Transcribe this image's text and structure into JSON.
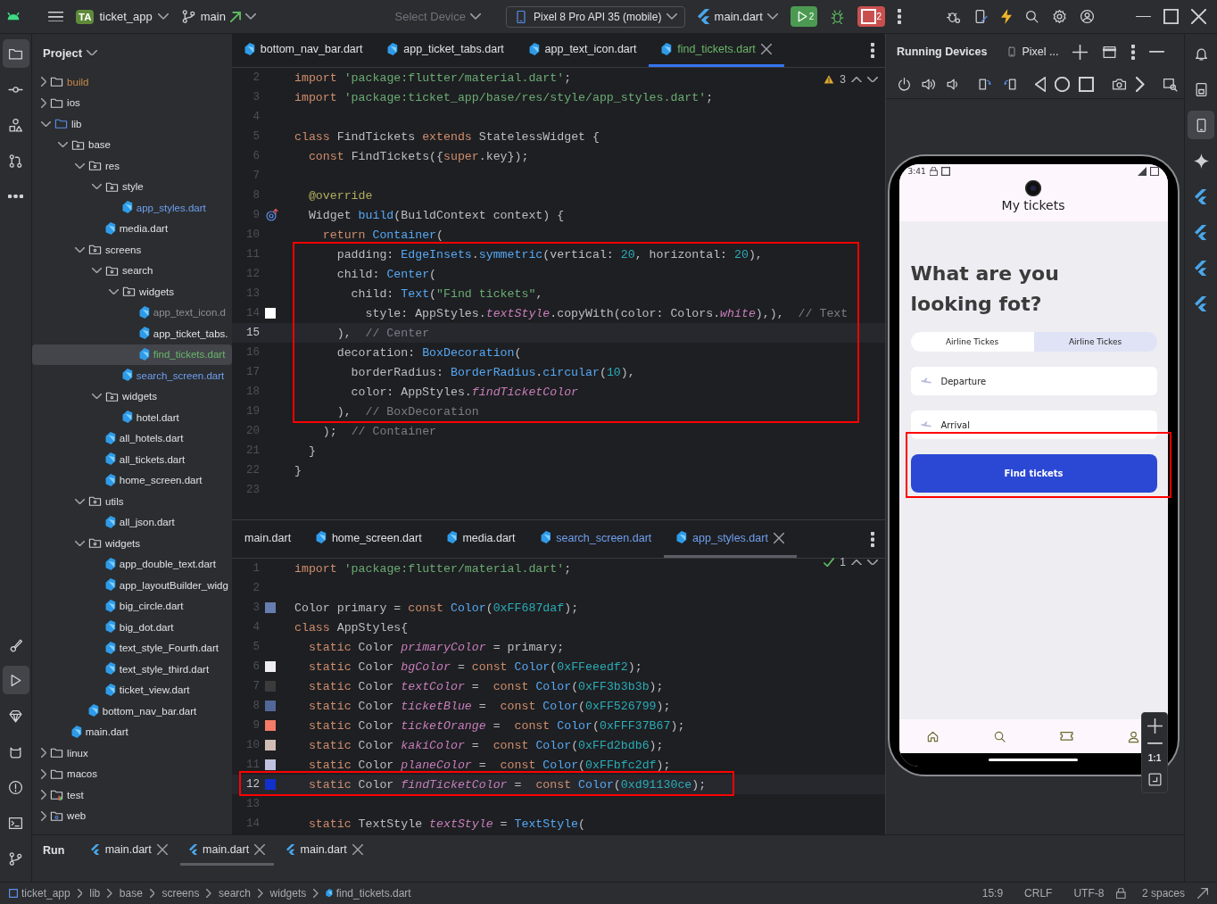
{
  "toolbar": {
    "project_badge": "TA",
    "project": "ticket_app",
    "branch": "main",
    "device_placeholder": "Select Device",
    "device": "Pixel 8 Pro API 35 (mobile)",
    "run_config": "main.dart",
    "run_count": "2",
    "stop_count": "2"
  },
  "left_toolbar": [
    {
      "selected": true
    },
    {
      "selected": false
    },
    {
      "selected": false
    },
    {
      "selected": false
    },
    {
      "selected": false
    },
    {
      "selected": false
    },
    {
      "selected": true
    },
    {
      "selected": false
    },
    {
      "selected": false
    },
    {
      "selected": false
    },
    {
      "selected": false
    },
    {
      "selected": false
    }
  ],
  "right_toolbar": [
    {
      "selected": false
    },
    {
      "selected": false
    },
    {
      "selected": true
    },
    {
      "selected": false
    },
    {
      "selected": false
    },
    {
      "selected": false
    },
    {
      "selected": false
    },
    {
      "selected": false
    }
  ],
  "project_panel": {
    "title": "Project",
    "tree": [
      {
        "label": "build",
        "kind": "folder",
        "color": "#c98a4b",
        "expanded": false,
        "selected": false
      },
      {
        "label": "ios",
        "kind": "folder",
        "expanded": false,
        "selected": false
      },
      {
        "label": "lib",
        "kind": "source",
        "expanded": true,
        "selected": false,
        "children": [
          {
            "label": "base",
            "kind": "package",
            "expanded": true,
            "selected": false,
            "children": [
              {
                "label": "res",
                "kind": "package",
                "expanded": true,
                "selected": false,
                "children": [
                  {
                    "label": "style",
                    "kind": "package",
                    "expanded": true,
                    "selected": false,
                    "children": [
                      {
                        "label": "app_styles.dart",
                        "kind": "dart",
                        "color": "#6f9ff0",
                        "selected": false
                      }
                    ]
                  },
                  {
                    "label": "media.dart",
                    "kind": "dart",
                    "selected": false
                  }
                ]
              },
              {
                "label": "screens",
                "kind": "package",
                "expanded": true,
                "selected": false,
                "children": [
                  {
                    "label": "search",
                    "kind": "package",
                    "expanded": true,
                    "selected": false,
                    "children": [
                      {
                        "label": "widgets",
                        "kind": "package",
                        "expanded": true,
                        "selected": false,
                        "children": [
                          {
                            "label": "app_text_icon.d",
                            "kind": "dart",
                            "color": "#8c8f96",
                            "selected": false
                          },
                          {
                            "label": "app_ticket_tabs.",
                            "kind": "dart",
                            "selected": false
                          },
                          {
                            "label": "find_tickets.dart",
                            "kind": "dart",
                            "color": "#6ab56a",
                            "selected": true
                          }
                        ]
                      },
                      {
                        "label": "search_screen.dart",
                        "kind": "dart",
                        "color": "#6f9ff0",
                        "selected": false
                      }
                    ]
                  },
                  {
                    "label": "widgets",
                    "kind": "package",
                    "expanded": true,
                    "selected": false,
                    "children": [
                      {
                        "label": "hotel.dart",
                        "kind": "dart",
                        "selected": false
                      }
                    ]
                  },
                  {
                    "label": "all_hotels.dart",
                    "kind": "dart",
                    "selected": false
                  },
                  {
                    "label": "all_tickets.dart",
                    "kind": "dart",
                    "selected": false
                  },
                  {
                    "label": "home_screen.dart",
                    "kind": "dart",
                    "selected": false
                  }
                ]
              },
              {
                "label": "utils",
                "kind": "package",
                "expanded": true,
                "selected": false,
                "children": [
                  {
                    "label": "all_json.dart",
                    "kind": "dart",
                    "selected": false
                  }
                ]
              },
              {
                "label": "widgets",
                "kind": "package",
                "expanded": true,
                "selected": false,
                "children": [
                  {
                    "label": "app_double_text.dart",
                    "kind": "dart",
                    "selected": false
                  },
                  {
                    "label": "app_layoutBuilder_widg",
                    "kind": "dart",
                    "selected": false
                  },
                  {
                    "label": "big_circle.dart",
                    "kind": "dart",
                    "selected": false
                  },
                  {
                    "label": "big_dot.dart",
                    "kind": "dart",
                    "selected": false
                  },
                  {
                    "label": "text_style_Fourth.dart",
                    "kind": "dart",
                    "selected": false
                  },
                  {
                    "label": "text_style_third.dart",
                    "kind": "dart",
                    "selected": false
                  },
                  {
                    "label": "ticket_view.dart",
                    "kind": "dart",
                    "selected": false
                  }
                ]
              },
              {
                "label": "bottom_nav_bar.dart",
                "kind": "dart",
                "selected": false
              }
            ]
          },
          {
            "label": "main.dart",
            "kind": "dart",
            "selected": false
          }
        ]
      },
      {
        "label": "linux",
        "kind": "folder",
        "expanded": false,
        "selected": false
      },
      {
        "label": "macos",
        "kind": "folder",
        "expanded": false,
        "selected": false
      },
      {
        "label": "test",
        "kind": "test",
        "expanded": false,
        "selected": false
      },
      {
        "label": "web",
        "kind": "web",
        "expanded": false,
        "selected": false
      }
    ]
  },
  "editors": [
    {
      "highlight": true,
      "problems": {
        "kind": "warning",
        "count": "3"
      },
      "tabs": [
        {
          "label": "bottom_nav_bar.dart",
          "icon": true,
          "selected": false
        },
        {
          "label": "app_ticket_tabs.dart",
          "icon": true,
          "selected": false
        },
        {
          "label": "app_text_icon.dart",
          "icon": true,
          "selected": false
        },
        {
          "label": "find_tickets.dart",
          "icon": true,
          "color": "#6ab56a",
          "selected": true
        }
      ],
      "lines": [
        {
          "no": "2",
          "current": false,
          "tokens": [
            {
              "kind": "kw",
              "text": "import "
            },
            {
              "kind": "str",
              "text": "'package:flutter/material.dart'"
            },
            {
              "kind": "pl",
              "text": ";"
            }
          ]
        },
        {
          "no": "3",
          "current": false,
          "tokens": [
            {
              "kind": "kw",
              "text": "import "
            },
            {
              "kind": "str",
              "text": "'package:ticket_app/base/res/style/app_styles.dart'"
            },
            {
              "kind": "pl",
              "text": ";"
            }
          ]
        },
        {
          "no": "4",
          "current": false
        },
        {
          "no": "5",
          "current": false,
          "tokens": [
            {
              "kind": "kw",
              "text": "class "
            },
            {
              "kind": "pl",
              "text": "FindTickets "
            },
            {
              "kind": "kw",
              "text": "extends "
            },
            {
              "kind": "pl",
              "text": "StatelessWidget {"
            }
          ]
        },
        {
          "no": "6",
          "current": false,
          "tokens": [
            {
              "kind": "kw",
              "text": "  const "
            },
            {
              "kind": "pl",
              "text": "FindTickets({"
            },
            {
              "kind": "kw",
              "text": "super"
            },
            {
              "kind": "pl",
              "text": ".key});"
            }
          ]
        },
        {
          "no": "7",
          "current": false
        },
        {
          "no": "8",
          "current": false,
          "tokens": [
            {
              "kind": "an",
              "text": "  @override"
            }
          ]
        },
        {
          "no": "9",
          "current": false,
          "gutter": {
            "kind": "override"
          },
          "tokens": [
            {
              "kind": "pl",
              "text": "  Widget "
            },
            {
              "kind": "fn",
              "text": "build"
            },
            {
              "kind": "pl",
              "text": "(BuildContext context) {"
            }
          ]
        },
        {
          "no": "10",
          "current": false,
          "tokens": [
            {
              "kind": "kw",
              "text": "    return "
            },
            {
              "kind": "fn",
              "text": "Container"
            },
            {
              "kind": "pl",
              "text": "("
            }
          ]
        },
        {
          "no": "11",
          "current": false,
          "tokens": [
            {
              "kind": "pl",
              "text": "      padding: "
            },
            {
              "kind": "fn",
              "text": "EdgeInsets"
            },
            {
              "kind": "pl",
              "text": "."
            },
            {
              "kind": "fn",
              "text": "symmetric"
            },
            {
              "kind": "pl",
              "text": "(vertical: "
            },
            {
              "kind": "num",
              "text": "20"
            },
            {
              "kind": "pl",
              "text": ", horizontal: "
            },
            {
              "kind": "num",
              "text": "20"
            },
            {
              "kind": "pl",
              "text": "),"
            }
          ]
        },
        {
          "no": "12",
          "current": false,
          "tokens": [
            {
              "kind": "pl",
              "text": "      child: "
            },
            {
              "kind": "fn",
              "text": "Center"
            },
            {
              "kind": "pl",
              "text": "("
            }
          ]
        },
        {
          "no": "13",
          "current": false,
          "tokens": [
            {
              "kind": "pl",
              "text": "        child: "
            },
            {
              "kind": "fn",
              "text": "Text"
            },
            {
              "kind": "pl",
              "text": "("
            },
            {
              "kind": "str",
              "text": "\"Find tickets\""
            },
            {
              "kind": "pl",
              "text": ","
            }
          ]
        },
        {
          "no": "14",
          "current": false,
          "color": "#ffffff",
          "tokens": [
            {
              "kind": "pl",
              "text": "          style: AppStyles."
            },
            {
              "kind": "it",
              "text": "textStyle"
            },
            {
              "kind": "pl",
              "text": ".copyWith(color: Colors."
            },
            {
              "kind": "it",
              "text": "white"
            },
            {
              "kind": "pl",
              "text": "),),  "
            },
            {
              "kind": "cm",
              "text": "// Text"
            }
          ]
        },
        {
          "no": "15",
          "current": true,
          "tokens": [
            {
              "kind": "pl",
              "text": "      ),  "
            },
            {
              "kind": "cm",
              "text": "// Center"
            }
          ]
        },
        {
          "no": "16",
          "current": false,
          "tokens": [
            {
              "kind": "pl",
              "text": "      decoration: "
            },
            {
              "kind": "fn",
              "text": "BoxDecoration"
            },
            {
              "kind": "pl",
              "text": "("
            }
          ]
        },
        {
          "no": "17",
          "current": false,
          "tokens": [
            {
              "kind": "pl",
              "text": "        borderRadius: "
            },
            {
              "kind": "fn",
              "text": "BorderRadius"
            },
            {
              "kind": "pl",
              "text": "."
            },
            {
              "kind": "fn",
              "text": "circular"
            },
            {
              "kind": "pl",
              "text": "("
            },
            {
              "kind": "num",
              "text": "10"
            },
            {
              "kind": "pl",
              "text": "),"
            }
          ]
        },
        {
          "no": "18",
          "current": false,
          "tokens": [
            {
              "kind": "pl",
              "text": "        color: AppStyles."
            },
            {
              "kind": "it",
              "text": "findTicketColor"
            }
          ]
        },
        {
          "no": "19",
          "current": false,
          "tokens": [
            {
              "kind": "pl",
              "text": "      ),  "
            },
            {
              "kind": "cm",
              "text": "// BoxDecoration"
            }
          ]
        },
        {
          "no": "20",
          "current": false,
          "tokens": [
            {
              "kind": "pl",
              "text": "    );  "
            },
            {
              "kind": "cm",
              "text": "// Container"
            }
          ]
        },
        {
          "no": "21",
          "current": false,
          "tokens": [
            {
              "kind": "pl",
              "text": "  }"
            }
          ]
        },
        {
          "no": "22",
          "current": false,
          "tokens": [
            {
              "kind": "pl",
              "text": "}"
            }
          ]
        },
        {
          "no": "23",
          "current": false
        }
      ]
    },
    {
      "highlight": true,
      "problems": {
        "kind": "ok",
        "count": "1"
      },
      "tabs": [
        {
          "label": "main.dart",
          "icon": false,
          "selected": false
        },
        {
          "label": "home_screen.dart",
          "icon": true,
          "selected": false
        },
        {
          "label": "media.dart",
          "icon": true,
          "selected": false
        },
        {
          "label": "search_screen.dart",
          "icon": true,
          "color": "#6f9ff0",
          "selected": false
        },
        {
          "label": "app_styles.dart",
          "icon": true,
          "color": "#6f9ff0",
          "selected": true
        }
      ],
      "lines": [
        {
          "no": "1",
          "current": false,
          "tokens": [
            {
              "kind": "kw",
              "text": "import "
            },
            {
              "kind": "str",
              "text": "'package:flutter/material.dart'"
            },
            {
              "kind": "pl",
              "text": ";"
            }
          ]
        },
        {
          "no": "2",
          "current": false
        },
        {
          "no": "3",
          "current": false,
          "color": "#687daf",
          "tokens": [
            {
              "kind": "pl",
              "text": "Color primary = "
            },
            {
              "kind": "kw",
              "text": "const "
            },
            {
              "kind": "fn",
              "text": "Color"
            },
            {
              "kind": "pl",
              "text": "("
            },
            {
              "kind": "num",
              "text": "0xFF687daf"
            },
            {
              "kind": "pl",
              "text": ");"
            }
          ]
        },
        {
          "no": "4",
          "current": false,
          "tokens": [
            {
              "kind": "kw",
              "text": "class "
            },
            {
              "kind": "pl",
              "text": "AppStyles{"
            }
          ]
        },
        {
          "no": "5",
          "current": false,
          "tokens": [
            {
              "kind": "kw",
              "text": "  static "
            },
            {
              "kind": "pl",
              "text": "Color "
            },
            {
              "kind": "it",
              "text": "primaryColor"
            },
            {
              "kind": "pl",
              "text": " = primary;"
            }
          ]
        },
        {
          "no": "6",
          "current": false,
          "color": "#eeedf2",
          "tokens": [
            {
              "kind": "kw",
              "text": "  static "
            },
            {
              "kind": "pl",
              "text": "Color "
            },
            {
              "kind": "it",
              "text": "bgColor"
            },
            {
              "kind": "pl",
              "text": " = "
            },
            {
              "kind": "kw",
              "text": "const "
            },
            {
              "kind": "fn",
              "text": "Color"
            },
            {
              "kind": "pl",
              "text": "("
            },
            {
              "kind": "num",
              "text": "0xFFeeedf2"
            },
            {
              "kind": "pl",
              "text": ");"
            }
          ]
        },
        {
          "no": "7",
          "current": false,
          "color": "#3b3b3b",
          "tokens": [
            {
              "kind": "kw",
              "text": "  static "
            },
            {
              "kind": "pl",
              "text": "Color "
            },
            {
              "kind": "it",
              "text": "textColor"
            },
            {
              "kind": "pl",
              "text": " =  "
            },
            {
              "kind": "kw",
              "text": "const "
            },
            {
              "kind": "fn",
              "text": "Color"
            },
            {
              "kind": "pl",
              "text": "("
            },
            {
              "kind": "num",
              "text": "0xFF3b3b3b"
            },
            {
              "kind": "pl",
              "text": ");"
            }
          ]
        },
        {
          "no": "8",
          "current": false,
          "color": "#526799",
          "tokens": [
            {
              "kind": "kw",
              "text": "  static "
            },
            {
              "kind": "pl",
              "text": "Color "
            },
            {
              "kind": "it",
              "text": "ticketBlue"
            },
            {
              "kind": "pl",
              "text": " =  "
            },
            {
              "kind": "kw",
              "text": "const "
            },
            {
              "kind": "fn",
              "text": "Color"
            },
            {
              "kind": "pl",
              "text": "("
            },
            {
              "kind": "num",
              "text": "0xFF526799"
            },
            {
              "kind": "pl",
              "text": ");"
            }
          ]
        },
        {
          "no": "9",
          "current": false,
          "color": "#f37b67",
          "tokens": [
            {
              "kind": "kw",
              "text": "  static "
            },
            {
              "kind": "pl",
              "text": "Color "
            },
            {
              "kind": "it",
              "text": "ticketOrange"
            },
            {
              "kind": "pl",
              "text": " =  "
            },
            {
              "kind": "kw",
              "text": "const "
            },
            {
              "kind": "fn",
              "text": "Color"
            },
            {
              "kind": "pl",
              "text": "("
            },
            {
              "kind": "num",
              "text": "0xFFF37B67"
            },
            {
              "kind": "pl",
              "text": ");"
            }
          ]
        },
        {
          "no": "10",
          "current": false,
          "color": "#d2bdb6",
          "tokens": [
            {
              "kind": "kw",
              "text": "  static "
            },
            {
              "kind": "pl",
              "text": "Color "
            },
            {
              "kind": "it",
              "text": "kakiColor"
            },
            {
              "kind": "pl",
              "text": " =  "
            },
            {
              "kind": "kw",
              "text": "const "
            },
            {
              "kind": "fn",
              "text": "Color"
            },
            {
              "kind": "pl",
              "text": "("
            },
            {
              "kind": "num",
              "text": "0xFFd2bdb6"
            },
            {
              "kind": "pl",
              "text": ");"
            }
          ]
        },
        {
          "no": "11",
          "current": false,
          "color": "#bfc2df",
          "tokens": [
            {
              "kind": "kw",
              "text": "  static "
            },
            {
              "kind": "pl",
              "text": "Color "
            },
            {
              "kind": "it",
              "text": "planeColor"
            },
            {
              "kind": "pl",
              "text": " =  "
            },
            {
              "kind": "kw",
              "text": "const "
            },
            {
              "kind": "fn",
              "text": "Color"
            },
            {
              "kind": "pl",
              "text": "("
            },
            {
              "kind": "num",
              "text": "0xFFbfc2df"
            },
            {
              "kind": "pl",
              "text": ");"
            }
          ]
        },
        {
          "no": "12",
          "current": true,
          "color": "#1130ce",
          "tokens": [
            {
              "kind": "kw",
              "text": "  static "
            },
            {
              "kind": "pl",
              "text": "Color "
            },
            {
              "kind": "it",
              "text": "findTicketColor"
            },
            {
              "kind": "pl",
              "text": " =  "
            },
            {
              "kind": "kw",
              "text": "const "
            },
            {
              "kind": "fn",
              "text": "Color"
            },
            {
              "kind": "pl",
              "text": "("
            },
            {
              "kind": "num",
              "text": "0xd91130ce"
            },
            {
              "kind": "pl",
              "text": ");"
            }
          ]
        },
        {
          "no": "13",
          "current": false
        },
        {
          "no": "14",
          "current": false,
          "tokens": [
            {
              "kind": "kw",
              "text": "  static "
            },
            {
              "kind": "pl",
              "text": "TextStyle "
            },
            {
              "kind": "it",
              "text": "textStyle"
            },
            {
              "kind": "pl",
              "text": " = "
            },
            {
              "kind": "fn",
              "text": "TextStyle"
            },
            {
              "kind": "pl",
              "text": "("
            }
          ]
        }
      ]
    }
  ],
  "device_panel": {
    "title": "Running Devices",
    "tab": "Pixel ...",
    "zoom_reset": "1:1",
    "phone": {
      "time": "3:41",
      "app_title": "My tickets",
      "heading": "What are you looking fot?",
      "tabs": [
        {
          "label": "Airline Tickes",
          "selected": true
        },
        {
          "label": "Airline Tickes",
          "selected": false
        }
      ],
      "inputs": [
        {
          "text": "Departure"
        },
        {
          "text": "Arrival"
        }
      ],
      "button": {
        "label": "Find tickets",
        "highlight": true
      }
    }
  },
  "run_panel": {
    "title": "Run",
    "tabs": [
      {
        "label": "main.dart",
        "selected": false
      },
      {
        "label": "main.dart",
        "selected": true
      },
      {
        "label": "main.dart",
        "selected": false
      }
    ]
  },
  "status_bar": {
    "breadcrumbs": [
      "ticket_app",
      "lib",
      "base",
      "screens",
      "search",
      "widgets",
      "find_tickets.dart"
    ],
    "position": "15:9",
    "line_ending": "CRLF",
    "encoding": "UTF-8",
    "indent": "2 spaces"
  }
}
